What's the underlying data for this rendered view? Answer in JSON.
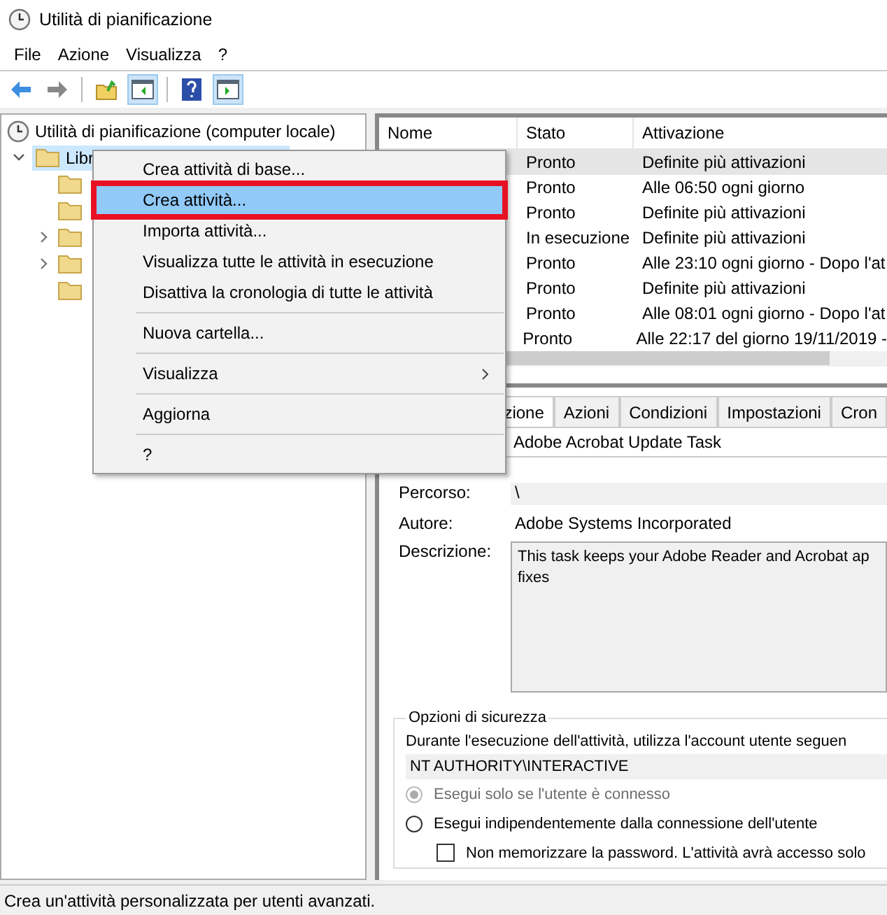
{
  "window": {
    "title": "Utilità di pianificazione"
  },
  "menu_bar": [
    "File",
    "Azione",
    "Visualizza",
    "?"
  ],
  "tree": {
    "root": "Utilità di pianificazione (computer locale)",
    "library": {
      "label": "Libr",
      "expanded": true,
      "selected": true,
      "children": [
        {
          "has_children": false
        },
        {
          "has_children": false
        },
        {
          "has_children": true
        },
        {
          "has_children": true
        },
        {
          "has_children": false
        }
      ]
    }
  },
  "task_list": {
    "columns": [
      "Nome",
      "Stato",
      "Attivazione"
    ],
    "rows": [
      {
        "status": "Pronto",
        "trigger": "Definite più attivazioni",
        "selected": true
      },
      {
        "status": "Pronto",
        "trigger": "Alle 06:50 ogni giorno",
        "selected": false
      },
      {
        "status": "Pronto",
        "trigger": "Definite più attivazioni",
        "selected": false
      },
      {
        "status": "In esecuzione",
        "trigger": "Definite più attivazioni",
        "selected": false
      },
      {
        "status": "Pronto",
        "trigger": "Alle 23:10 ogni giorno - Dopo l'at",
        "selected": false
      },
      {
        "status": "Pronto",
        "trigger": "Definite più attivazioni",
        "selected": false
      },
      {
        "status": "Pronto",
        "trigger": "Alle 08:01 ogni giorno - Dopo l'at",
        "selected": false
      },
      {
        "status": "Pronto",
        "trigger": "Alle 22:17 del giorno 19/11/2019 -",
        "selected": false
      }
    ]
  },
  "detail_tabs": [
    {
      "label": "zione",
      "selected": true
    },
    {
      "label": "Azioni",
      "selected": false
    },
    {
      "label": "Condizioni",
      "selected": false
    },
    {
      "label": "Impostazioni",
      "selected": false
    },
    {
      "label": "Cron",
      "selected": false
    }
  ],
  "general": {
    "name_value": "Adobe Acrobat Update Task",
    "path_label": "Percorso:",
    "path_value": "\\",
    "author_label": "Autore:",
    "author_value": "Adobe Systems Incorporated",
    "description_label": "Descrizione:",
    "description_lines": [
      "This task keeps your Adobe Reader and Acrobat ap",
      "fixes"
    ],
    "security": {
      "title": "Opzioni di sicurezza",
      "account_prompt": "Durante l'esecuzione dell'attività, utilizza l'account utente seguen",
      "account": "NT AUTHORITY\\INTERACTIVE",
      "options": [
        {
          "kind": "radio",
          "label": "Esegui solo se l'utente è connesso",
          "checked": true,
          "disabled": true
        },
        {
          "kind": "radio",
          "label": "Esegui indipendentemente dalla connessione dell'utente",
          "checked": false,
          "disabled": false
        },
        {
          "kind": "checkbox",
          "label": "Non memorizzare la password. L'attività avrà accesso solo",
          "checked": false
        }
      ]
    }
  },
  "context_menu": [
    {
      "kind": "item",
      "label": "Crea attività di base...",
      "selected": false,
      "annotated": false
    },
    {
      "kind": "item",
      "label": "Crea attività...",
      "selected": true,
      "annotated": true
    },
    {
      "kind": "item",
      "label": "Importa attività...",
      "selected": false,
      "annotated": false
    },
    {
      "kind": "item",
      "label": "Visualizza tutte le attività in esecuzione",
      "selected": false,
      "annotated": false
    },
    {
      "kind": "item",
      "label": "Disattiva la cronologia di tutte le attività",
      "selected": false,
      "annotated": false
    },
    {
      "kind": "separator"
    },
    {
      "kind": "item",
      "label": "Nuova cartella...",
      "selected": false,
      "annotated": false
    },
    {
      "kind": "separator"
    },
    {
      "kind": "submenu",
      "label": "Visualizza",
      "selected": false,
      "annotated": false
    },
    {
      "kind": "separator"
    },
    {
      "kind": "item",
      "label": "Aggiorna",
      "selected": false,
      "annotated": false
    },
    {
      "kind": "separator"
    },
    {
      "kind": "item",
      "label": "?",
      "selected": false,
      "annotated": false
    }
  ],
  "status_bar": "Crea un'attività personalizzata per utenti avanzati."
}
